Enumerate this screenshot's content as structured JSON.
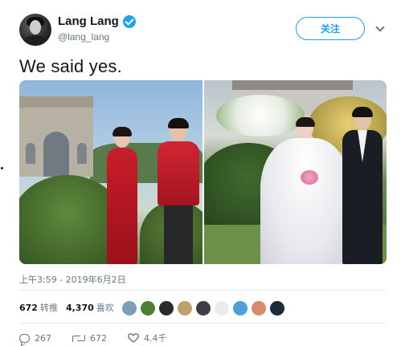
{
  "user": {
    "name": "Lang Lang",
    "handle": "@lang_lang",
    "verified": true
  },
  "follow_button": {
    "label": "关注"
  },
  "tweet": {
    "text": "We said yes.",
    "timestamp": "上午3:59 - 2019年6月2日"
  },
  "stats": {
    "retweets_count": "672",
    "retweets_label": "转推",
    "likes_count": "4,370",
    "likes_label": "喜欢"
  },
  "likers": [
    {
      "color": "#7a9fb6"
    },
    {
      "color": "#4f7d3a"
    },
    {
      "color": "#2b2b2b"
    },
    {
      "color": "#c0a06b"
    },
    {
      "color": "#3a3f45"
    },
    {
      "color": "#e7ecee"
    },
    {
      "color": "#4fa0d9"
    },
    {
      "color": "#d98a6a"
    },
    {
      "color": "#1c2a3a"
    }
  ],
  "actions": {
    "reply_count": "267",
    "retweet_count": "672",
    "like_count": "4.4千"
  },
  "colors": {
    "accent": "#1da1f2",
    "text": "#14171a",
    "muted": "#657786"
  }
}
